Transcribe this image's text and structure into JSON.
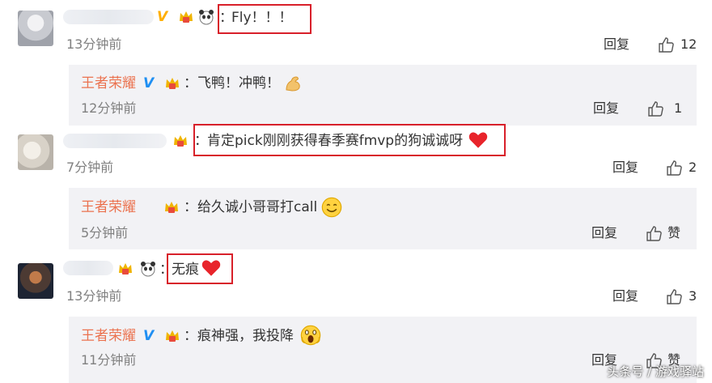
{
  "comments": [
    {
      "content": "Fly！！！",
      "time": "13分钟前",
      "reply_label": "回复",
      "likes": "12",
      "reply": {
        "author": "王者荣耀",
        "content": "飞鸭！冲鸭！",
        "time": "12分钟前",
        "reply_label": "回复",
        "likes": "1"
      }
    },
    {
      "content": "肯定pick刚刚获得春季赛fmvp的狗诚诚呀",
      "time": "7分钟前",
      "reply_label": "回复",
      "likes": "2",
      "reply": {
        "author": "王者荣耀",
        "content": "给久诚小哥哥打call",
        "time": "5分钟前",
        "reply_label": "回复",
        "likes": "赞"
      }
    },
    {
      "content": "无痕",
      "time": "13分钟前",
      "reply_label": "回复",
      "likes": "3",
      "reply": {
        "author": "王者荣耀",
        "content": "痕神强，我投降",
        "time": "11分钟前",
        "reply_label": "回复",
        "likes": "赞"
      }
    }
  ],
  "colon": "：",
  "verified_mark": "V",
  "watermark": "头条号 / 游戏驿站",
  "colors": {
    "accent": "#eb7350",
    "highlight_box": "#d8202a",
    "reply_bg": "#f2f2f5",
    "verified_blue": "#1f8ff2",
    "verified_gold": "#ffae00"
  }
}
